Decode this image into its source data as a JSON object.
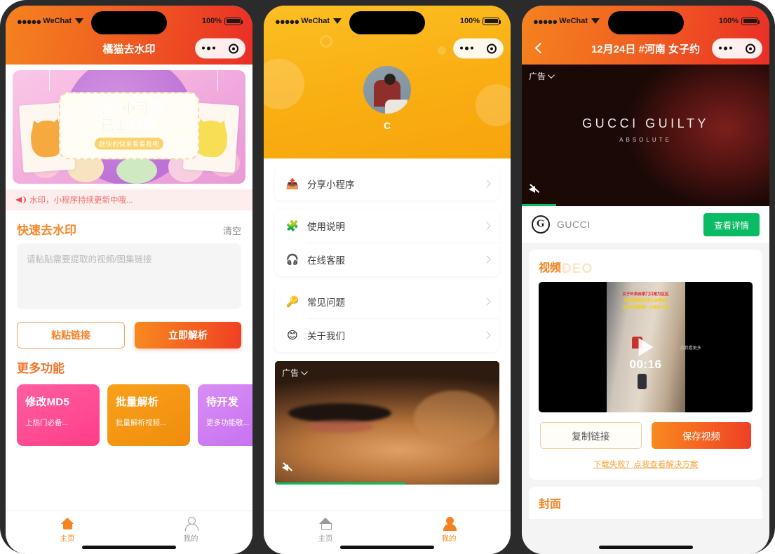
{
  "status_bar": {
    "carrier": "WeChat",
    "signal_dots": "●●●●●",
    "battery_percent": "100%"
  },
  "capsule": {
    "more_label": "•••",
    "target_label": "⊙"
  },
  "screen1": {
    "nav_title": "橘猫去水印",
    "banner": {
      "line1": "您的小可爱",
      "line2": "已上线啦",
      "sub": "赶快的快来看看我吧"
    },
    "notice": "水印，小程序持续更新中哦...",
    "section": {
      "title": "快速去水印",
      "action": "清空"
    },
    "textarea_placeholder": "请粘贴需要提取的视频/图集链接",
    "buttons": {
      "paste": "粘贴链接",
      "parse": "立即解析"
    },
    "more": {
      "title": "更多功能"
    },
    "cards": [
      {
        "title": "修改MD5",
        "desc": "上热门必备..."
      },
      {
        "title": "批量解析",
        "desc": "批量解析视频..."
      },
      {
        "title": "待开发",
        "desc": "更多功能敬..."
      }
    ],
    "tabs": [
      {
        "label": "主页",
        "icon": "home-icon",
        "active": true
      },
      {
        "label": "我的",
        "icon": "user-icon",
        "active": false
      }
    ]
  },
  "screen2": {
    "nickname": "C",
    "groups": [
      [
        {
          "label": "分享小程序",
          "emoji": "📤"
        }
      ],
      [
        {
          "label": "使用说明",
          "emoji": "🧩"
        },
        {
          "label": "在线客服",
          "emoji": "🎧"
        }
      ],
      [
        {
          "label": "常见问题",
          "emoji": "🔑"
        },
        {
          "label": "关于我们",
          "emoji": "😊"
        }
      ]
    ],
    "ad": {
      "tag": "广告",
      "progress_percent": 58
    },
    "tabs": [
      {
        "label": "主页",
        "icon": "home-icon",
        "active": false
      },
      {
        "label": "我的",
        "icon": "user-icon",
        "active": true
      }
    ]
  },
  "screen3": {
    "nav_title": "12月24日 #河南 女子约",
    "ad": {
      "tag": "广告",
      "headline": "GUCCI GUILTY",
      "subline": "ABSOLUTE",
      "brand": "GUCCI",
      "cta": "查看详情",
      "progress_percent": 14
    },
    "video_section": {
      "title_cn": "视频",
      "title_en": "VIDEO",
      "duration": "00:16",
      "overlay_line1": "女子外卖自家门口是为区区",
      "overlay_line2": "当年视频时间怎么会等9点",
      "overlay_line3": "记录大家照顾一心相关人员",
      "watermark_left": "门铃动态\\n视频",
      "watermark_right": "点我看更多"
    },
    "buttons": {
      "copy": "复制链接",
      "save": "保存视频"
    },
    "fail_link": "下载失败？点我查看解决方案",
    "cover_section": {
      "title": "封面"
    }
  }
}
